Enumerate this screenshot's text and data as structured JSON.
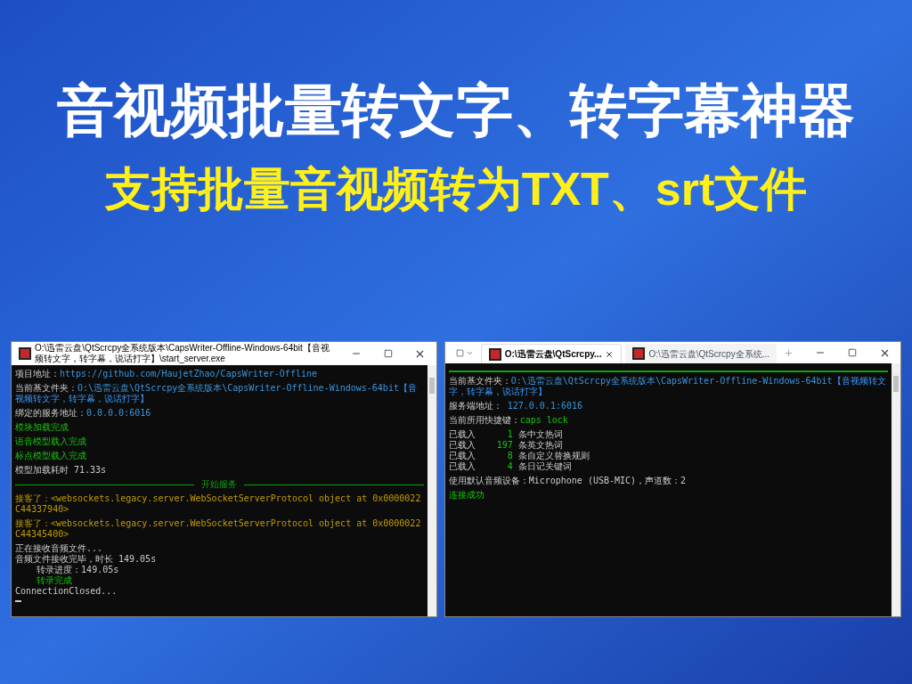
{
  "headline": {
    "title": "音视频批量转文字、转字幕神器",
    "subtitle": "支持批量音视频转为TXT、srt文件"
  },
  "server_window": {
    "title": "O:\\迅雷云盘\\QtScrcpy全系统版本\\CapsWriter-Offline-Windows-64bit【音视频转文字，转字幕，说话打字】\\start_server.exe",
    "lines": [
      {
        "kind": "text",
        "segments": [
          {
            "text": "项目地址：",
            "kind": "plain"
          },
          {
            "text": "https://github.com/HaujetZhao/CapsWriter-Offline",
            "kind": "value"
          }
        ]
      },
      {
        "kind": "blank"
      },
      {
        "kind": "text",
        "segments": [
          {
            "text": "当前基文件夹：",
            "kind": "plain"
          },
          {
            "text": "O:\\迅雷云盘\\QtScrcpy全系统版本\\CapsWriter-Offline-Windows-64bit",
            "kind": "value"
          },
          {
            "text": "【音视频转文字，转字幕，说话打字】",
            "kind": "note"
          }
        ]
      },
      {
        "kind": "blank"
      },
      {
        "kind": "text",
        "segments": [
          {
            "text": "绑定的服务地址：",
            "kind": "plain"
          },
          {
            "text": "0.0.0.0:6016",
            "kind": "value"
          }
        ]
      },
      {
        "kind": "blank"
      },
      {
        "kind": "text",
        "segments": [
          {
            "text": "模块加载完成",
            "kind": "success"
          }
        ]
      },
      {
        "kind": "blank"
      },
      {
        "kind": "text",
        "segments": [
          {
            "text": "语音模型载入完成",
            "kind": "success"
          }
        ]
      },
      {
        "kind": "blank"
      },
      {
        "kind": "text",
        "segments": [
          {
            "text": "标点模型载入完成",
            "kind": "success"
          }
        ]
      },
      {
        "kind": "blank"
      },
      {
        "kind": "text",
        "segments": [
          {
            "text": "模型加载耗时 71.33s",
            "kind": "plain"
          }
        ]
      },
      {
        "kind": "rule",
        "label": "开始服务"
      },
      {
        "kind": "text",
        "segments": [
          {
            "text": "接客了：<websockets.legacy.server.WebSocketServerProtocol object at 0x0000022C44337940>",
            "kind": "event"
          }
        ]
      },
      {
        "kind": "blank"
      },
      {
        "kind": "text",
        "segments": [
          {
            "text": "接客了：<websockets.legacy.server.WebSocketServerProtocol object at 0x0000022C44345400>",
            "kind": "event"
          }
        ]
      },
      {
        "kind": "blank"
      },
      {
        "kind": "text",
        "segments": [
          {
            "text": "正在接收音频文件...",
            "kind": "plain"
          }
        ]
      },
      {
        "kind": "text",
        "segments": [
          {
            "text": "音频文件接收完毕，时长 149.05s",
            "kind": "plain"
          }
        ]
      },
      {
        "kind": "text",
        "segments": [
          {
            "text": "    转录进度：149.05s",
            "kind": "plain"
          }
        ]
      },
      {
        "kind": "text",
        "segments": [
          {
            "text": "    转录完成",
            "kind": "success"
          }
        ]
      },
      {
        "kind": "text",
        "segments": [
          {
            "text": "ConnectionClosed...",
            "kind": "plain"
          }
        ]
      },
      {
        "kind": "cursor"
      }
    ]
  },
  "client_window": {
    "tabs": [
      {
        "label": "O:\\迅雷云盘\\QtScrcpy...",
        "selected": true
      },
      {
        "label": "O:\\迅雷云盘\\QtScrcpy全系统...",
        "selected": false
      }
    ],
    "lines": [
      {
        "kind": "rule"
      },
      {
        "kind": "blank"
      },
      {
        "kind": "text",
        "segments": [
          {
            "text": "当前基文件夹：",
            "kind": "plain"
          },
          {
            "text": "O:\\迅雷云盘\\QtScrcpy全系统版本\\CapsWriter-Offline-Windows-64bit",
            "kind": "value"
          },
          {
            "text": "【音视频转文字，转字幕，说话打字】",
            "kind": "note"
          }
        ]
      },
      {
        "kind": "blank"
      },
      {
        "kind": "text",
        "segments": [
          {
            "text": "服务端地址： ",
            "kind": "plain"
          },
          {
            "text": "127.0.0.1:6016",
            "kind": "value"
          }
        ]
      },
      {
        "kind": "blank"
      },
      {
        "kind": "text",
        "segments": [
          {
            "text": "当前所用快捷键：",
            "kind": "plain"
          },
          {
            "text": "caps lock",
            "kind": "success"
          }
        ]
      },
      {
        "kind": "blank"
      },
      {
        "kind": "text",
        "segments": [
          {
            "text": "已载入",
            "kind": "plain"
          },
          {
            "text": "      1",
            "kind": "success"
          },
          {
            "text": " 条中文热词",
            "kind": "plain"
          }
        ]
      },
      {
        "kind": "text",
        "segments": [
          {
            "text": "已载入",
            "kind": "plain"
          },
          {
            "text": "    197",
            "kind": "success"
          },
          {
            "text": " 条英文热词",
            "kind": "plain"
          }
        ]
      },
      {
        "kind": "text",
        "segments": [
          {
            "text": "已载入",
            "kind": "plain"
          },
          {
            "text": "      8",
            "kind": "success"
          },
          {
            "text": " 条自定义替换规则",
            "kind": "plain"
          }
        ]
      },
      {
        "kind": "text",
        "segments": [
          {
            "text": "已载入",
            "kind": "plain"
          },
          {
            "text": "      4",
            "kind": "success"
          },
          {
            "text": " 条日记关键词",
            "kind": "plain"
          }
        ]
      },
      {
        "kind": "blank"
      },
      {
        "kind": "text",
        "segments": [
          {
            "text": "使用默认音频设备：Microphone (USB-MIC)，声道数：2",
            "kind": "plain"
          }
        ]
      },
      {
        "kind": "blank"
      },
      {
        "kind": "text",
        "segments": [
          {
            "text": "连接成功",
            "kind": "success"
          }
        ]
      }
    ]
  }
}
